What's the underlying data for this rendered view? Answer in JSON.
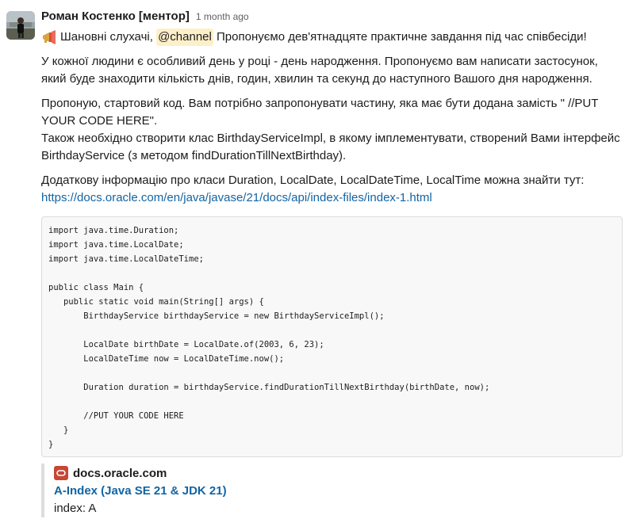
{
  "message": {
    "author": "Роман Костенко [ментор]",
    "timestamp": "1 month ago",
    "intro_icon": "megaphone-icon",
    "greeting": "Шановні слухачі,",
    "mention": "@channel",
    "intro_rest": "Пропонуємо дев'ятнадцяте практичне завдання під час співбесіди!",
    "para1_line1": "У кожної людини є особливий день у році - день народження. Пропонуємо вам написати застосунок,",
    "para1_line2": "який буде знаходити кількість днів, годин, хвилин та секунд до наступного Вашого дня народження.",
    "para2_line1": "Пропоную, стартовий код. Вам потрібно запропонувати частину, яка має бути додана замість \" //PUT",
    "para2_line2": "YOUR CODE HERE\".",
    "para2_line3": "Також необхідно створити клас BirthdayServiceImpl, в якому імплементувати, створений Вами інтерфейс",
    "para2_line4": "BirthdayService (з методом findDurationTillNextBirthday).",
    "para3_line1": "Додаткову інформацію про класи Duration, LocalDate, LocalDateTime, LocalTime можна знайти тут:",
    "link": "https://docs.oracle.com/en/java/javase/21/docs/api/index-files/index-1.html"
  },
  "code_lines": [
    "import java.time.Duration;",
    "import java.time.LocalDate;",
    "import java.time.LocalDateTime;",
    "",
    "public class Main {",
    "   public static void main(String[] args) {",
    "       BirthdayService birthdayService = new BirthdayServiceImpl();",
    "",
    "       LocalDate birthDate = LocalDate.of(2003, 6, 23);",
    "       LocalDateTime now = LocalDateTime.now();",
    "",
    "       Duration duration = birthdayService.findDurationTillNextBirthday(birthDate, now);",
    "",
    "       //PUT YOUR CODE HERE",
    "   }",
    "}"
  ],
  "unfurl": {
    "site_icon": "oracle-logo-icon",
    "site_name": "docs.oracle.com",
    "title": "A-Index (Java SE 21 & JDK 21)",
    "description": "index: A"
  },
  "colors": {
    "link": "#1264a3",
    "mention_bg": "#fdf0c8",
    "oracle_red": "#c74634",
    "code_bg": "#f8f8f8"
  }
}
